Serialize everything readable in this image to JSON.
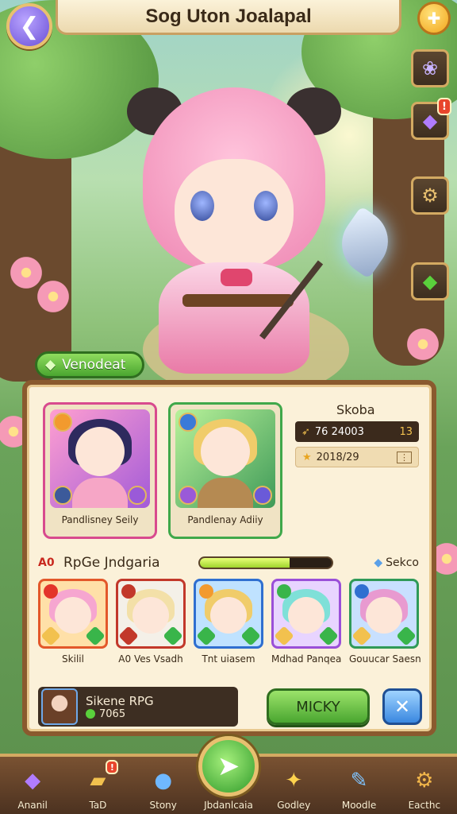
{
  "header": {
    "title": "Sog Uton Joalapal",
    "back_glyph": "❮",
    "gem_glyph": "✚"
  },
  "side_buttons": [
    {
      "name": "crystal-flower-icon",
      "glyph": "❀",
      "color": "#c9b4ff",
      "badge": ""
    },
    {
      "name": "purple-gem-icon",
      "glyph": "◆",
      "color": "#b07cff",
      "badge": "!"
    },
    {
      "name": "gear-icon",
      "glyph": "⚙",
      "color": "#e8c070",
      "badge": ""
    },
    {
      "name": "green-leaf-icon",
      "glyph": "◆",
      "color": "#5ad13c",
      "badge": ""
    }
  ],
  "section_tag": "Venodeat",
  "featured": [
    {
      "name": "Pandlisney Seily",
      "frame_color": "#d84a8e",
      "hair": "#2e2a5e",
      "body": "#f6a6c6",
      "bg": "linear-gradient(135deg,#ff9fd0,#a35bd8)"
    },
    {
      "name": "Pandlenay Adiiy",
      "frame_color": "#3fa84a",
      "hair": "#f0cc6a",
      "body": "#b58a52",
      "bg": "linear-gradient(135deg,#b9f29a,#3f9a58)"
    }
  ],
  "stats": {
    "title": "Skoba",
    "rows": [
      {
        "value": "76 24003",
        "extra": "13"
      },
      {
        "value": "2018/29",
        "extra": "⋮"
      }
    ]
  },
  "team": {
    "code": "A0",
    "name": "RpGe Jndgaria",
    "progress": 0.68,
    "right_label": "Sekco"
  },
  "roster": [
    {
      "name": "Skilil",
      "frame": "#e3582a",
      "hair": "#f6a6d0",
      "bg": "#ffe0a8"
    },
    {
      "name": "A0 Ves Vsadh",
      "frame": "#c2382a",
      "hair": "#f3e0a8",
      "bg": "#f4f0e8"
    },
    {
      "name": "Tnt uiasem",
      "frame": "#2f6fd0",
      "hair": "#f0cc6a",
      "bg": "#bfe2ff"
    },
    {
      "name": "Mdhad Panqea",
      "frame": "#9a4fd8",
      "hair": "#7fe0d8",
      "bg": "#e8d4ff"
    },
    {
      "name": "Gouucar Saesn",
      "frame": "#2f9a58",
      "hair": "#e89ad0",
      "bg": "#c8e0ff"
    }
  ],
  "player": {
    "name": "Sikene RPG",
    "value": "7065"
  },
  "actions": {
    "primary": "MICKY",
    "close_glyph": "✕"
  },
  "bottom_nav": [
    {
      "label": "Ananil",
      "glyph": "◆",
      "color": "#b07cff",
      "badge": ""
    },
    {
      "label": "TaD",
      "glyph": "▰",
      "color": "#f2c14e",
      "badge": "!"
    },
    {
      "label": "Stony",
      "glyph": "●",
      "color": "#6fb8ff",
      "badge": ""
    },
    {
      "label": "Jbdanlcaia",
      "glyph": "➤",
      "color": "#ffffff",
      "badge": "",
      "center": true
    },
    {
      "label": "Godley",
      "glyph": "✦",
      "color": "#ffd34e",
      "badge": ""
    },
    {
      "label": "Moodle",
      "glyph": "✎",
      "color": "#7fc4ff",
      "badge": ""
    },
    {
      "label": "Eacthc",
      "glyph": "⚙",
      "color": "#f2b64a",
      "badge": ""
    }
  ]
}
